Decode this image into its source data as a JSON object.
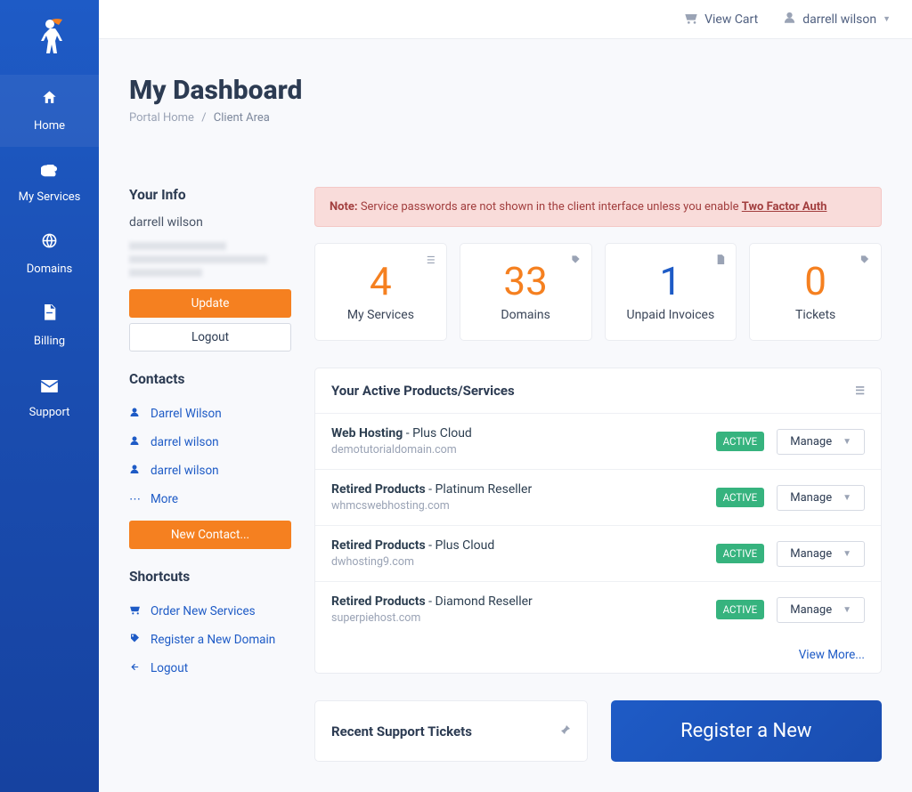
{
  "topbar": {
    "cart": "View Cart",
    "user": "darrell wilson"
  },
  "sidebar": {
    "items": [
      {
        "label": "Home"
      },
      {
        "label": "My Services"
      },
      {
        "label": "Domains"
      },
      {
        "label": "Billing"
      },
      {
        "label": "Support"
      }
    ]
  },
  "page": {
    "title": "My Dashboard",
    "breadcrumb_home": "Portal Home",
    "breadcrumb_current": "Client Area"
  },
  "yourinfo": {
    "heading": "Your Info",
    "name": "darrell wilson",
    "update": "Update",
    "logout": "Logout"
  },
  "contacts": {
    "heading": "Contacts",
    "items": [
      {
        "name": "Darrel Wilson"
      },
      {
        "name": "darrel wilson"
      },
      {
        "name": "darrel wilson"
      }
    ],
    "more": "More",
    "new": "New Contact..."
  },
  "shortcuts": {
    "heading": "Shortcuts",
    "items": [
      {
        "label": "Order New Services"
      },
      {
        "label": "Register a New Domain"
      },
      {
        "label": "Logout"
      }
    ]
  },
  "alert": {
    "note": "Note:",
    "text": " Service passwords are not shown in the client interface unless you enable ",
    "link": "Two Factor Auth"
  },
  "stats": [
    {
      "value": "4",
      "label": "My Services",
      "color": "orange"
    },
    {
      "value": "33",
      "label": "Domains",
      "color": "orange"
    },
    {
      "value": "1",
      "label": "Unpaid Invoices",
      "color": "blue"
    },
    {
      "value": "0",
      "label": "Tickets",
      "color": "orange"
    }
  ],
  "products": {
    "heading": "Your Active Products/Services",
    "status_label": "ACTIVE",
    "manage_label": "Manage",
    "viewmore": "View More...",
    "rows": [
      {
        "name": "Web Hosting",
        "plan": "Plus Cloud",
        "domain": "demotutorialdomain.com"
      },
      {
        "name": "Retired Products",
        "plan": "Platinum Reseller",
        "domain": "whmcswebhosting.com"
      },
      {
        "name": "Retired Products",
        "plan": "Plus Cloud",
        "domain": "dwhosting9.com"
      },
      {
        "name": "Retired Products",
        "plan": "Diamond Reseller",
        "domain": "superpiehost.com"
      }
    ]
  },
  "tickets": {
    "heading": "Recent Support Tickets"
  },
  "register": {
    "heading": "Register a New"
  }
}
